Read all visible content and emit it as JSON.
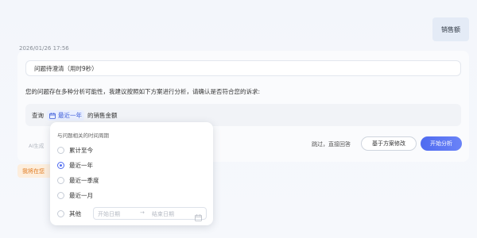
{
  "user_message": "销售额",
  "timestamp": "2026/01/26 17:56",
  "status": "问题待澄清（用时9秒）",
  "prompt": "您的问题存在多种分析可能性，我建议按照如下方案进行分析，请确认是否符合您的诉求:",
  "query": {
    "prefix": "查询",
    "time_chip": "最近一年",
    "suffix": "的销售金额"
  },
  "ai_note": "AI生成",
  "actions": {
    "skip": "跳过，直接回答",
    "modify": "基于方案修改",
    "start": "开始分析"
  },
  "orange_tag": "我将在您",
  "popover": {
    "title": "与问题相关的时间周期",
    "options": [
      "累计至今",
      "最近一年",
      "最近一季度",
      "最近一月",
      "其他"
    ],
    "selected": "最近一年",
    "date_start_placeholder": "开始日期",
    "date_end_placeholder": "结束日期"
  },
  "colors": {
    "accent": "#4f6bf0",
    "orange": "#e07a1f"
  },
  "icons": {
    "calendar": "calendar-icon",
    "arrow": "arrow-right-icon"
  }
}
